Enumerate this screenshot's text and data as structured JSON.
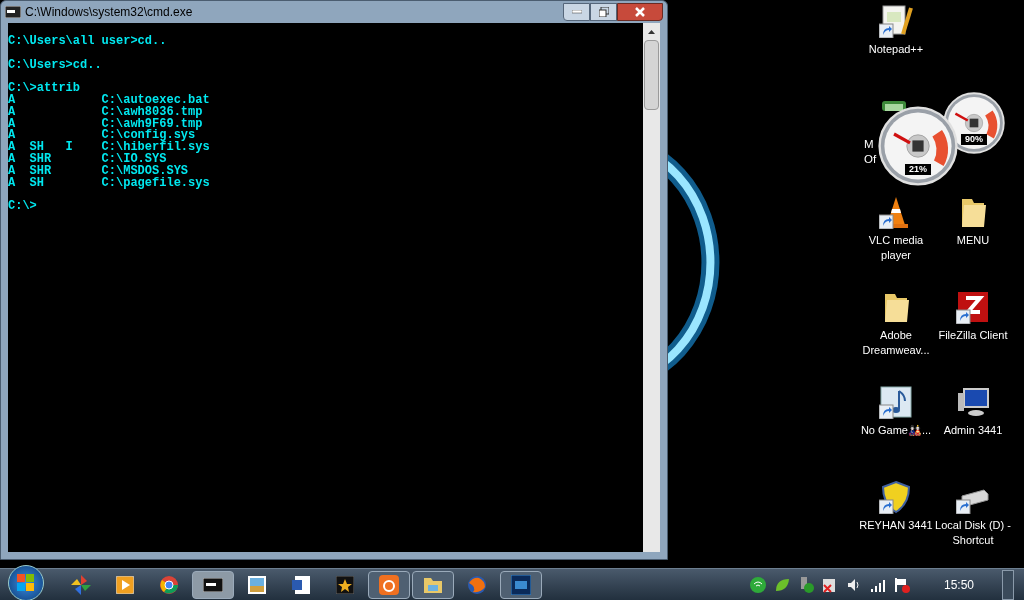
{
  "console_window": {
    "title": "C:\\Windows\\system32\\cmd.exe",
    "blocks": [
      [
        "C:\\Users\\all user>cd.."
      ],
      [
        "C:\\Users>cd.."
      ],
      [
        "C:\\>attrib",
        "A            C:\\autoexec.bat",
        "A            C:\\awh8036.tmp",
        "A            C:\\awh9F69.tmp",
        "A            C:\\config.sys",
        "A  SH   I    C:\\hiberfil.sys",
        "A  SHR       C:\\IO.SYS",
        "A  SHR       C:\\MSDOS.SYS",
        "A  SH        C:\\pagefile.sys"
      ],
      [
        "C:\\>"
      ]
    ]
  },
  "covered_icon": {
    "label_lines": [
      "M",
      "Of"
    ]
  },
  "desktop_icons": [
    {
      "label": "Notepad++",
      "shortcut": true
    },
    {
      "label": "VLC media player",
      "shortcut": true
    },
    {
      "label": "MENU",
      "shortcut": false
    },
    {
      "label": "Adobe Dreamweav...",
      "shortcut": false
    },
    {
      "label": "FileZilla Client",
      "shortcut": true
    },
    {
      "label": "No Game🎎...",
      "shortcut": true
    },
    {
      "label": "Admin 3441",
      "shortcut": false
    },
    {
      "label": "REYHAN 3441",
      "shortcut": true
    },
    {
      "label": "Local Disk (D) - Shortcut",
      "shortcut": true
    }
  ],
  "gadget": {
    "cpu_reading": "21%",
    "memory_reading": "90%"
  },
  "taskbar": {
    "items": [
      {
        "running": false,
        "selected": false
      },
      {
        "running": false,
        "selected": false
      },
      {
        "running": false,
        "selected": false
      },
      {
        "running": true,
        "selected": true
      },
      {
        "running": false,
        "selected": false
      },
      {
        "running": false,
        "selected": false
      },
      {
        "running": false,
        "selected": false
      },
      {
        "running": true,
        "selected": false
      },
      {
        "running": true,
        "selected": false
      },
      {
        "running": false,
        "selected": false
      },
      {
        "running": true,
        "selected": false
      }
    ],
    "clock": "15:50"
  }
}
